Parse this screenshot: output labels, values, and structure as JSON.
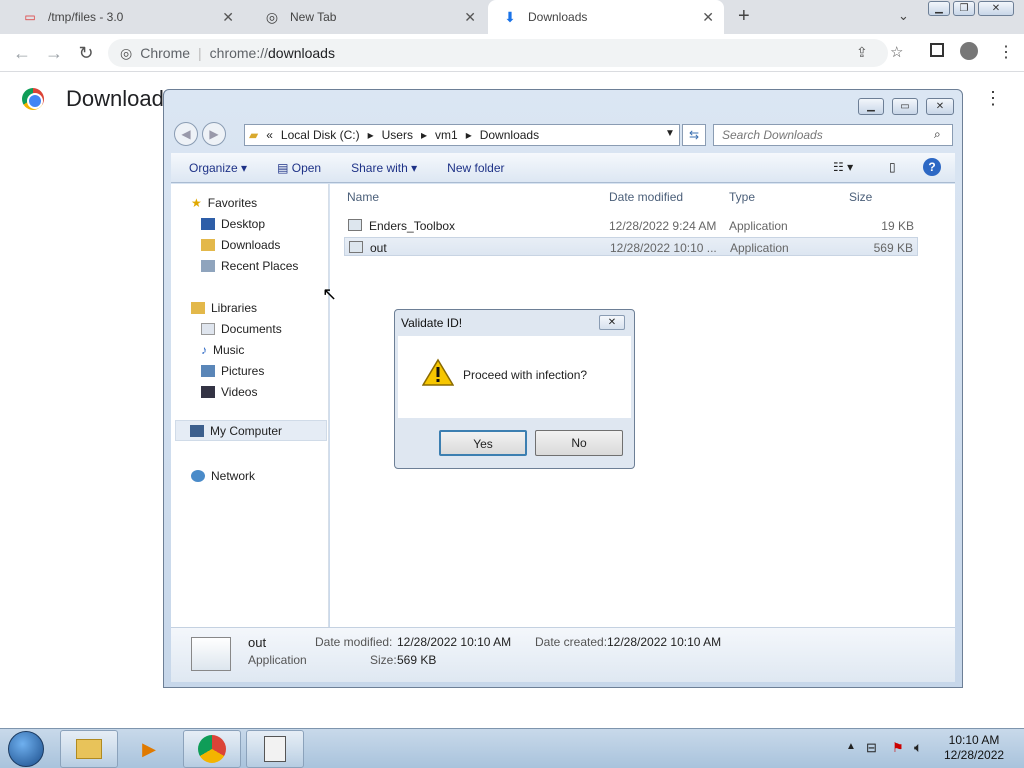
{
  "browser": {
    "tabs": [
      {
        "label": "/tmp/files - 3.0"
      },
      {
        "label": "New Tab"
      },
      {
        "label": "Downloads"
      }
    ],
    "omnibox": {
      "site": "Chrome",
      "url_prefix": "chrome://",
      "url_path": "downloads"
    },
    "page_title": "Download"
  },
  "explorer": {
    "breadcrumb": [
      "Local Disk (C:)",
      "Users",
      "vm1",
      "Downloads"
    ],
    "search_placeholder": "Search Downloads",
    "commands": {
      "organize": "Organize",
      "open": "Open",
      "share": "Share with",
      "new_folder": "New folder"
    },
    "nav": {
      "favorites": "Favorites",
      "desktop": "Desktop",
      "downloads": "Downloads",
      "recent": "Recent Places",
      "libraries": "Libraries",
      "documents": "Documents",
      "music": "Music",
      "pictures": "Pictures",
      "videos": "Videos",
      "computer": "My Computer",
      "network": "Network"
    },
    "columns": {
      "name": "Name",
      "date": "Date modified",
      "type": "Type",
      "size": "Size"
    },
    "files": [
      {
        "name": "Enders_Toolbox",
        "date": "12/28/2022 9:24 AM",
        "type": "Application",
        "size": "19 KB"
      },
      {
        "name": "out",
        "date": "12/28/2022 10:10 ...",
        "type": "Application",
        "size": "569 KB"
      }
    ],
    "details": {
      "name": "out",
      "kind": "Application",
      "modified_label": "Date modified:",
      "modified": "12/28/2022 10:10 AM",
      "created_label": "Date created:",
      "created": "12/28/2022 10:10 AM",
      "size_label": "Size:",
      "size": "569 KB"
    }
  },
  "dialog": {
    "title": "Validate ID!",
    "message": "Proceed with infection?",
    "yes": "Yes",
    "no": "No"
  },
  "taskbar": {
    "time": "10:10 AM",
    "date": "12/28/2022"
  }
}
